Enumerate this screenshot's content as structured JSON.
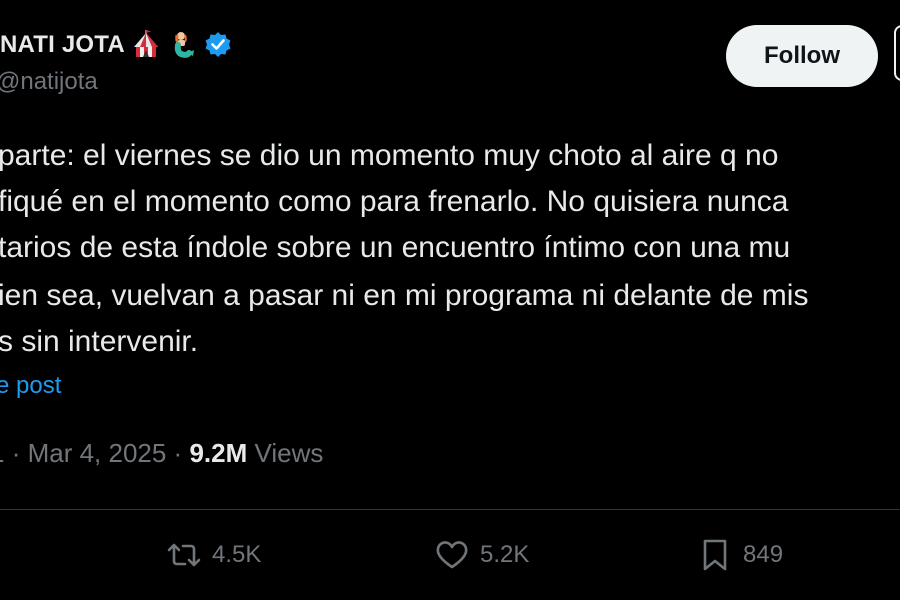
{
  "tweet": {
    "display_name": "NATI JOTA",
    "name_emojis": [
      "circus-tent-emoji",
      "mermaid-emoji"
    ],
    "verified": true,
    "handle": "@natijota",
    "follow_label": "Follow",
    "lines": [
      "parte: el viernes se dio un momento muy choto al aire q no",
      "fiqué en el momento como para frenarlo. No quisiera nunca",
      "tarios de esta índole sobre un encuentro íntimo con una mu",
      "ien sea, vuelvan a pasar ni en mi programa ni delante de mis",
      "s sin intervenir."
    ],
    "post_link": "e post",
    "meta": {
      "time_fragment": "1",
      "separator": " · ",
      "date": "Mar 4, 2025",
      "views_count": "9.2M",
      "views_label": "Views"
    },
    "actions": {
      "reposts": "4.5K",
      "likes": "5.2K",
      "bookmarks": "849"
    },
    "colors": {
      "background": "#000000",
      "text": "#e7e9ea",
      "muted": "#71767b",
      "link": "#1d9bf0",
      "verified_badge": "#1d9bf0",
      "follow_bg": "#eff3f4"
    }
  }
}
